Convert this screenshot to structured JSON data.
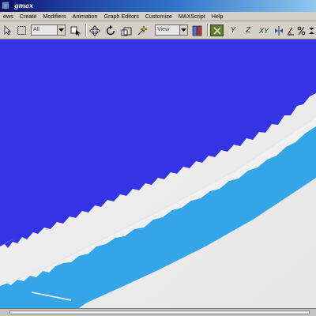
{
  "window": {
    "title": "gmax"
  },
  "menu": [
    "ews",
    "Create",
    "Modifiers",
    "Animation",
    "Graph Editors",
    "Customize",
    "MAXScript",
    "Help"
  ],
  "toolbar": {
    "selection_filter": "All",
    "coordinate_system": "View",
    "axis_constraints": [
      "X",
      "Y",
      "Z",
      "XY"
    ]
  },
  "colors": {
    "sky_blue": "#3434e6",
    "stripe_light_blue": "#34a6e8",
    "ground_white": "#f0f0f0",
    "active_axis": "#5b7a34"
  },
  "icons": [
    "arrow-select-icon",
    "region-select-icon",
    "select-by-name-icon",
    "move-icon",
    "rotate-icon",
    "scale-icon",
    "axis-x-icon",
    "axis-y-icon",
    "axis-z-icon",
    "axis-xy-icon",
    "snap-icon",
    "angle-snap-icon",
    "percent-snap-icon"
  ]
}
